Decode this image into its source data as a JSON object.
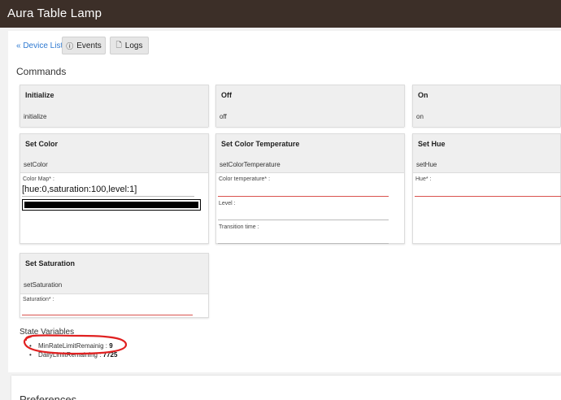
{
  "header": {
    "title": "Aura Table Lamp"
  },
  "nav": {
    "device_list": "« Device List",
    "events": "Events",
    "logs": "Logs"
  },
  "commands": {
    "title": "Commands",
    "initialize": {
      "label": "Initialize",
      "method": "initialize"
    },
    "off": {
      "label": "Off",
      "method": "off"
    },
    "on": {
      "label": "On",
      "method": "on"
    },
    "set_color": {
      "label": "Set Color",
      "method": "setColor",
      "field_label": "Color Map* :",
      "field_value": "[hue:0,saturation:100,level:1]"
    },
    "set_color_temperature": {
      "label": "Set Color Temperature",
      "method": "setColorTemperature",
      "field1_label": "Color temperature* :",
      "field2_label": "Level :",
      "field3_label": "Transition time :"
    },
    "set_hue": {
      "label": "Set Hue",
      "method": "setHue",
      "field_label": "Hue* :"
    },
    "set_saturation": {
      "label": "Set Saturation",
      "method": "setSaturation",
      "field_label": "Saturation* :"
    }
  },
  "state_variables": {
    "title": "State Variables",
    "items": [
      {
        "name": "MinRateLimitRemainig",
        "value": "9"
      },
      {
        "name": "DailyLimitRemaining",
        "value": "7725"
      }
    ]
  },
  "preferences": {
    "title": "Preferences"
  },
  "colors": {
    "header_bg": "#3c2f28",
    "link": "#2f7ad1",
    "required_line": "#d9534f",
    "annotation": "#e02020"
  }
}
